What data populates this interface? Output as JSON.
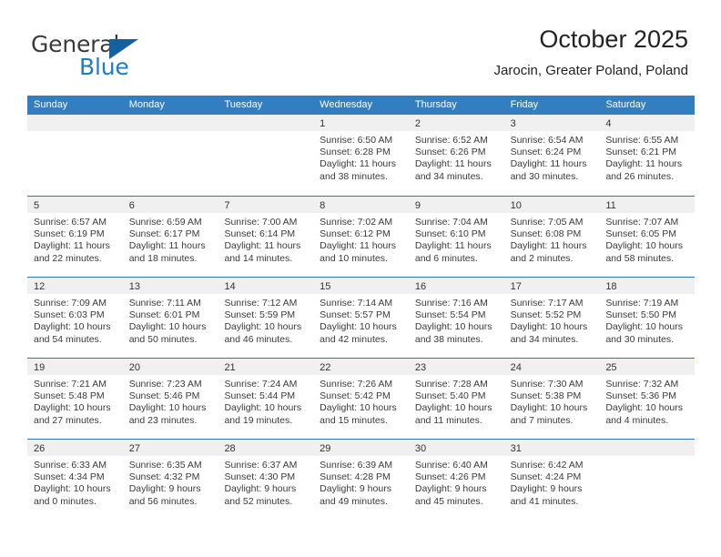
{
  "brand": {
    "name_part1": "General",
    "name_part2": "Blue",
    "accent_color": "#1f7cc4",
    "triangle_color": "#13629f"
  },
  "header": {
    "month_title": "October 2025",
    "location": "Jarocin, Greater Poland, Poland"
  },
  "calendar": {
    "header_color": "#337ec0",
    "daynum_band_color": "#f0f0f0",
    "weekday_headers": [
      "Sunday",
      "Monday",
      "Tuesday",
      "Wednesday",
      "Thursday",
      "Friday",
      "Saturday"
    ],
    "weeks": [
      [
        {
          "day": "",
          "sunrise": "",
          "sunset": "",
          "daylight_line1": "",
          "daylight_line2": "",
          "empty": true
        },
        {
          "day": "",
          "sunrise": "",
          "sunset": "",
          "daylight_line1": "",
          "daylight_line2": "",
          "empty": true
        },
        {
          "day": "",
          "sunrise": "",
          "sunset": "",
          "daylight_line1": "",
          "daylight_line2": "",
          "empty": true
        },
        {
          "day": "1",
          "sunrise": "Sunrise: 6:50 AM",
          "sunset": "Sunset: 6:28 PM",
          "daylight_line1": "Daylight: 11 hours",
          "daylight_line2": "and 38 minutes."
        },
        {
          "day": "2",
          "sunrise": "Sunrise: 6:52 AM",
          "sunset": "Sunset: 6:26 PM",
          "daylight_line1": "Daylight: 11 hours",
          "daylight_line2": "and 34 minutes."
        },
        {
          "day": "3",
          "sunrise": "Sunrise: 6:54 AM",
          "sunset": "Sunset: 6:24 PM",
          "daylight_line1": "Daylight: 11 hours",
          "daylight_line2": "and 30 minutes."
        },
        {
          "day": "4",
          "sunrise": "Sunrise: 6:55 AM",
          "sunset": "Sunset: 6:21 PM",
          "daylight_line1": "Daylight: 11 hours",
          "daylight_line2": "and 26 minutes."
        }
      ],
      [
        {
          "day": "5",
          "sunrise": "Sunrise: 6:57 AM",
          "sunset": "Sunset: 6:19 PM",
          "daylight_line1": "Daylight: 11 hours",
          "daylight_line2": "and 22 minutes."
        },
        {
          "day": "6",
          "sunrise": "Sunrise: 6:59 AM",
          "sunset": "Sunset: 6:17 PM",
          "daylight_line1": "Daylight: 11 hours",
          "daylight_line2": "and 18 minutes."
        },
        {
          "day": "7",
          "sunrise": "Sunrise: 7:00 AM",
          "sunset": "Sunset: 6:14 PM",
          "daylight_line1": "Daylight: 11 hours",
          "daylight_line2": "and 14 minutes."
        },
        {
          "day": "8",
          "sunrise": "Sunrise: 7:02 AM",
          "sunset": "Sunset: 6:12 PM",
          "daylight_line1": "Daylight: 11 hours",
          "daylight_line2": "and 10 minutes."
        },
        {
          "day": "9",
          "sunrise": "Sunrise: 7:04 AM",
          "sunset": "Sunset: 6:10 PM",
          "daylight_line1": "Daylight: 11 hours",
          "daylight_line2": "and 6 minutes."
        },
        {
          "day": "10",
          "sunrise": "Sunrise: 7:05 AM",
          "sunset": "Sunset: 6:08 PM",
          "daylight_line1": "Daylight: 11 hours",
          "daylight_line2": "and 2 minutes."
        },
        {
          "day": "11",
          "sunrise": "Sunrise: 7:07 AM",
          "sunset": "Sunset: 6:05 PM",
          "daylight_line1": "Daylight: 10 hours",
          "daylight_line2": "and 58 minutes."
        }
      ],
      [
        {
          "day": "12",
          "sunrise": "Sunrise: 7:09 AM",
          "sunset": "Sunset: 6:03 PM",
          "daylight_line1": "Daylight: 10 hours",
          "daylight_line2": "and 54 minutes."
        },
        {
          "day": "13",
          "sunrise": "Sunrise: 7:11 AM",
          "sunset": "Sunset: 6:01 PM",
          "daylight_line1": "Daylight: 10 hours",
          "daylight_line2": "and 50 minutes."
        },
        {
          "day": "14",
          "sunrise": "Sunrise: 7:12 AM",
          "sunset": "Sunset: 5:59 PM",
          "daylight_line1": "Daylight: 10 hours",
          "daylight_line2": "and 46 minutes."
        },
        {
          "day": "15",
          "sunrise": "Sunrise: 7:14 AM",
          "sunset": "Sunset: 5:57 PM",
          "daylight_line1": "Daylight: 10 hours",
          "daylight_line2": "and 42 minutes."
        },
        {
          "day": "16",
          "sunrise": "Sunrise: 7:16 AM",
          "sunset": "Sunset: 5:54 PM",
          "daylight_line1": "Daylight: 10 hours",
          "daylight_line2": "and 38 minutes."
        },
        {
          "day": "17",
          "sunrise": "Sunrise: 7:17 AM",
          "sunset": "Sunset: 5:52 PM",
          "daylight_line1": "Daylight: 10 hours",
          "daylight_line2": "and 34 minutes."
        },
        {
          "day": "18",
          "sunrise": "Sunrise: 7:19 AM",
          "sunset": "Sunset: 5:50 PM",
          "daylight_line1": "Daylight: 10 hours",
          "daylight_line2": "and 30 minutes."
        }
      ],
      [
        {
          "day": "19",
          "sunrise": "Sunrise: 7:21 AM",
          "sunset": "Sunset: 5:48 PM",
          "daylight_line1": "Daylight: 10 hours",
          "daylight_line2": "and 27 minutes."
        },
        {
          "day": "20",
          "sunrise": "Sunrise: 7:23 AM",
          "sunset": "Sunset: 5:46 PM",
          "daylight_line1": "Daylight: 10 hours",
          "daylight_line2": "and 23 minutes."
        },
        {
          "day": "21",
          "sunrise": "Sunrise: 7:24 AM",
          "sunset": "Sunset: 5:44 PM",
          "daylight_line1": "Daylight: 10 hours",
          "daylight_line2": "and 19 minutes."
        },
        {
          "day": "22",
          "sunrise": "Sunrise: 7:26 AM",
          "sunset": "Sunset: 5:42 PM",
          "daylight_line1": "Daylight: 10 hours",
          "daylight_line2": "and 15 minutes."
        },
        {
          "day": "23",
          "sunrise": "Sunrise: 7:28 AM",
          "sunset": "Sunset: 5:40 PM",
          "daylight_line1": "Daylight: 10 hours",
          "daylight_line2": "and 11 minutes."
        },
        {
          "day": "24",
          "sunrise": "Sunrise: 7:30 AM",
          "sunset": "Sunset: 5:38 PM",
          "daylight_line1": "Daylight: 10 hours",
          "daylight_line2": "and 7 minutes."
        },
        {
          "day": "25",
          "sunrise": "Sunrise: 7:32 AM",
          "sunset": "Sunset: 5:36 PM",
          "daylight_line1": "Daylight: 10 hours",
          "daylight_line2": "and 4 minutes."
        }
      ],
      [
        {
          "day": "26",
          "sunrise": "Sunrise: 6:33 AM",
          "sunset": "Sunset: 4:34 PM",
          "daylight_line1": "Daylight: 10 hours",
          "daylight_line2": "and 0 minutes."
        },
        {
          "day": "27",
          "sunrise": "Sunrise: 6:35 AM",
          "sunset": "Sunset: 4:32 PM",
          "daylight_line1": "Daylight: 9 hours",
          "daylight_line2": "and 56 minutes."
        },
        {
          "day": "28",
          "sunrise": "Sunrise: 6:37 AM",
          "sunset": "Sunset: 4:30 PM",
          "daylight_line1": "Daylight: 9 hours",
          "daylight_line2": "and 52 minutes."
        },
        {
          "day": "29",
          "sunrise": "Sunrise: 6:39 AM",
          "sunset": "Sunset: 4:28 PM",
          "daylight_line1": "Daylight: 9 hours",
          "daylight_line2": "and 49 minutes."
        },
        {
          "day": "30",
          "sunrise": "Sunrise: 6:40 AM",
          "sunset": "Sunset: 4:26 PM",
          "daylight_line1": "Daylight: 9 hours",
          "daylight_line2": "and 45 minutes."
        },
        {
          "day": "31",
          "sunrise": "Sunrise: 6:42 AM",
          "sunset": "Sunset: 4:24 PM",
          "daylight_line1": "Daylight: 9 hours",
          "daylight_line2": "and 41 minutes."
        },
        {
          "day": "",
          "sunrise": "",
          "sunset": "",
          "daylight_line1": "",
          "daylight_line2": "",
          "empty": true
        }
      ]
    ]
  }
}
